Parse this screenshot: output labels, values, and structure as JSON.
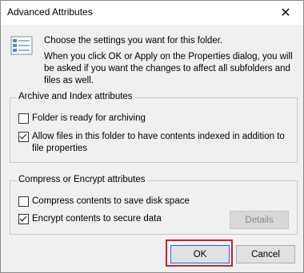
{
  "window": {
    "title": "Advanced Attributes",
    "close_glyph": "✕"
  },
  "intro": {
    "line1": "Choose the settings you want for this folder.",
    "line2": "When you click OK or Apply on the Properties dialog, you will be asked if you want the changes to affect all subfolders and files as well."
  },
  "archive_group": {
    "title": "Archive and Index attributes",
    "items": [
      {
        "label": "Folder is ready for archiving",
        "checked": false
      },
      {
        "label": "Allow files in this folder to have contents indexed in addition to file properties",
        "checked": true
      }
    ]
  },
  "compress_group": {
    "title": "Compress or Encrypt attributes",
    "items": [
      {
        "label": "Compress contents to save disk space",
        "checked": false
      },
      {
        "label": "Encrypt contents to secure data",
        "checked": true
      }
    ],
    "details_label": "Details"
  },
  "buttons": {
    "ok_label": "OK",
    "cancel_label": "Cancel"
  },
  "colors": {
    "highlight": "#c8222a",
    "accent": "#0078d7"
  }
}
